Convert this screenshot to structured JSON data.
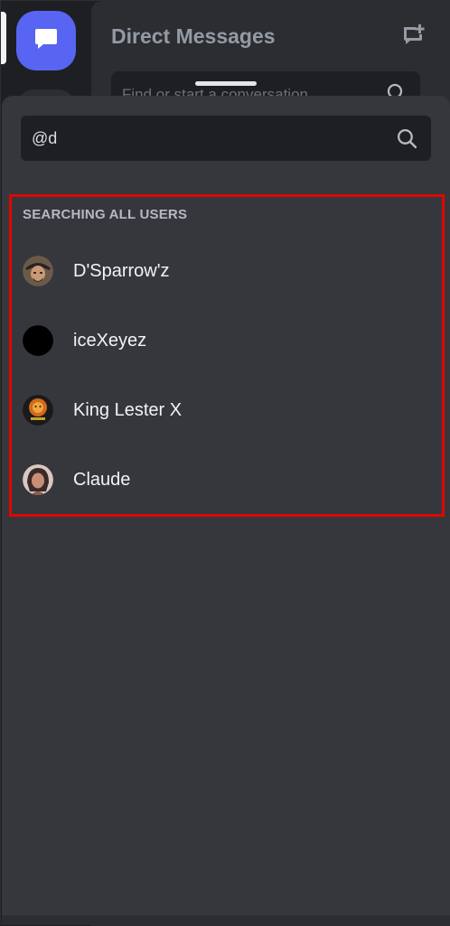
{
  "rail": {
    "home_icon": "chat-bubble-icon",
    "accent": "#5865f2"
  },
  "dm_panel": {
    "title": "Direct Messages",
    "search_placeholder": "Find or start a conversation",
    "new_dm_icon": "new-message-icon"
  },
  "search_sheet": {
    "query": "@d",
    "search_icon": "search-icon",
    "section_header": "SEARCHING ALL USERS",
    "highlight_color": "#e10600",
    "users": [
      {
        "name": "D'Sparrow'z",
        "avatar": "pirate-avatar"
      },
      {
        "name": "iceXeyez",
        "avatar": "black-avatar"
      },
      {
        "name": "King Lester X",
        "avatar": "lion-avatar"
      },
      {
        "name": "Claude",
        "avatar": "portrait-avatar"
      }
    ]
  }
}
